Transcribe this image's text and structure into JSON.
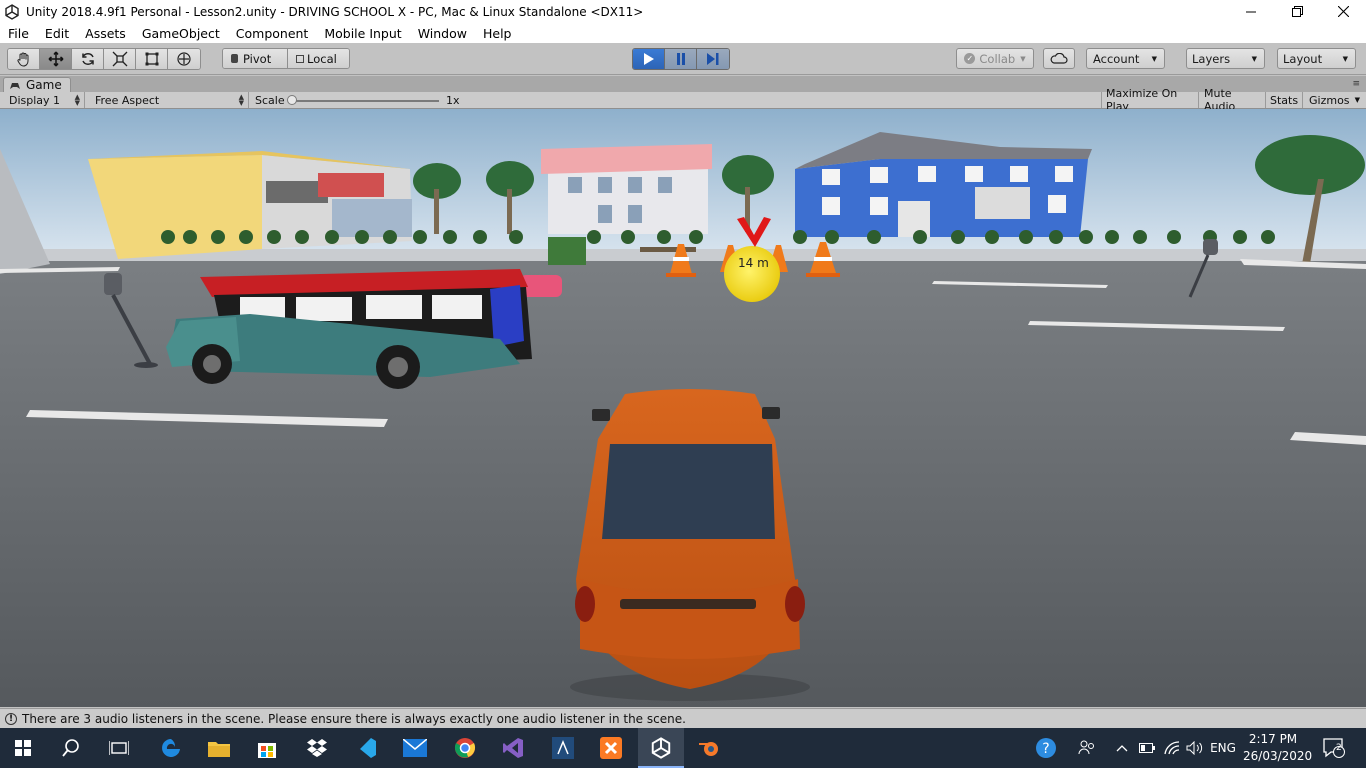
{
  "window": {
    "title": "Unity 2018.4.9f1 Personal - Lesson2.unity - DRIVING SCHOOL X - PC, Mac & Linux Standalone <DX11>"
  },
  "menu": [
    "File",
    "Edit",
    "Assets",
    "GameObject",
    "Component",
    "Mobile Input",
    "Window",
    "Help"
  ],
  "toolbar": {
    "tools": [
      "hand-tool",
      "move-tool",
      "rotate-tool",
      "scale-tool",
      "rect-tool",
      "transform-tool"
    ],
    "pivot_label": "Pivot",
    "local_label": "Local",
    "collab_label": "Collab",
    "account_label": "Account",
    "layers_label": "Layers",
    "layout_label": "Layout"
  },
  "game_panel": {
    "tab_label": "Game",
    "display_label": "Display 1",
    "aspect_label": "Free Aspect",
    "scale_label": "Scale",
    "scale_value": "1x",
    "maximize_label": "Maximize On Play",
    "mute_label": "Mute Audio",
    "stats_label": "Stats",
    "gizmos_label": "Gizmos"
  },
  "scene": {
    "distance_marker": "14 m",
    "colors": {
      "sky": "#dfe9f2",
      "asphalt": "#5d6266",
      "blue_house": "#3d6fd0",
      "player_car": "#d8661e",
      "marker": "#f5e21a",
      "arrow": "#e01818"
    }
  },
  "status": {
    "message": "There are 3 audio listeners in the scene. Please ensure there is always exactly one audio listener in the scene."
  },
  "taskbar": {
    "apps": [
      "windows-start",
      "search",
      "task-view",
      "edge",
      "file-explorer",
      "store",
      "dropbox",
      "visual-studio-code",
      "mail",
      "chrome",
      "visual-studio",
      "sourcetree",
      "xampp",
      "unity",
      "blender"
    ],
    "language": "ENG",
    "time": "2:17 PM",
    "date": "26/03/2020",
    "notifications": "2"
  }
}
